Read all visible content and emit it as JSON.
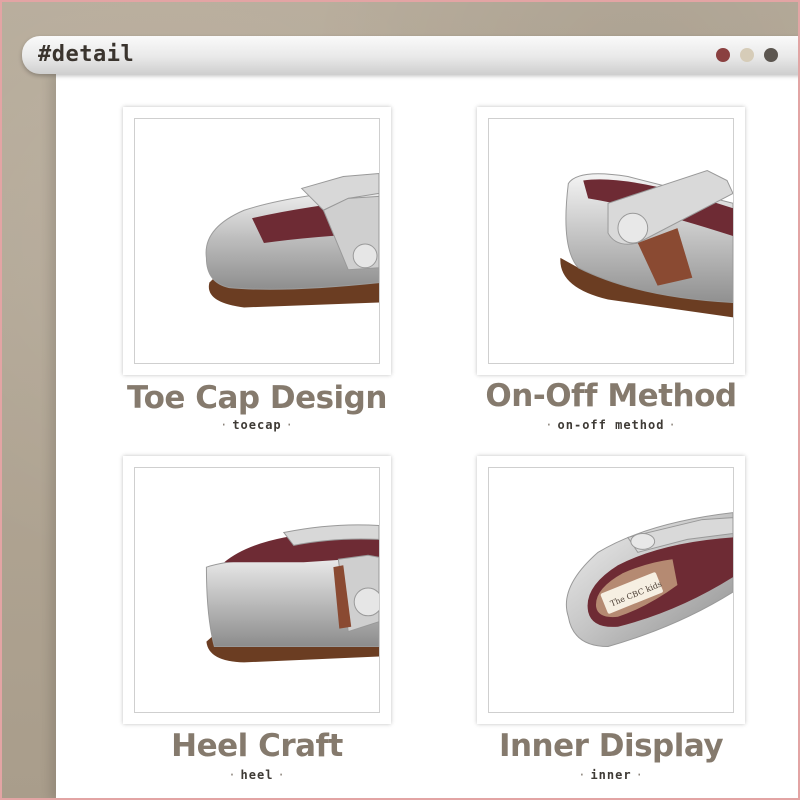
{
  "window": {
    "title": "#detail",
    "dot_colors": [
      "#8a4040",
      "#d6ccb8",
      "#5c5650"
    ]
  },
  "cards": [
    {
      "title": "Toe Cap Design",
      "subtitle": "toecap",
      "image": "shoe-toe-cap-photo"
    },
    {
      "title": "On-Off Method",
      "subtitle": "on-off method",
      "image": "shoe-strap-button-photo"
    },
    {
      "title": "Heel Craft",
      "subtitle": "heel",
      "image": "shoe-heel-photo"
    },
    {
      "title": "Inner Display",
      "subtitle": "inner",
      "image": "shoe-insole-photo",
      "insole_brand": "The CBC kids"
    }
  ],
  "colors": {
    "background": "#b3a796",
    "title_text": "#857a6d",
    "subtitle_text": "#3e3a35",
    "silver": "#c9c9c9",
    "lining": "#6e2b34",
    "sole": "#6b3d22"
  }
}
